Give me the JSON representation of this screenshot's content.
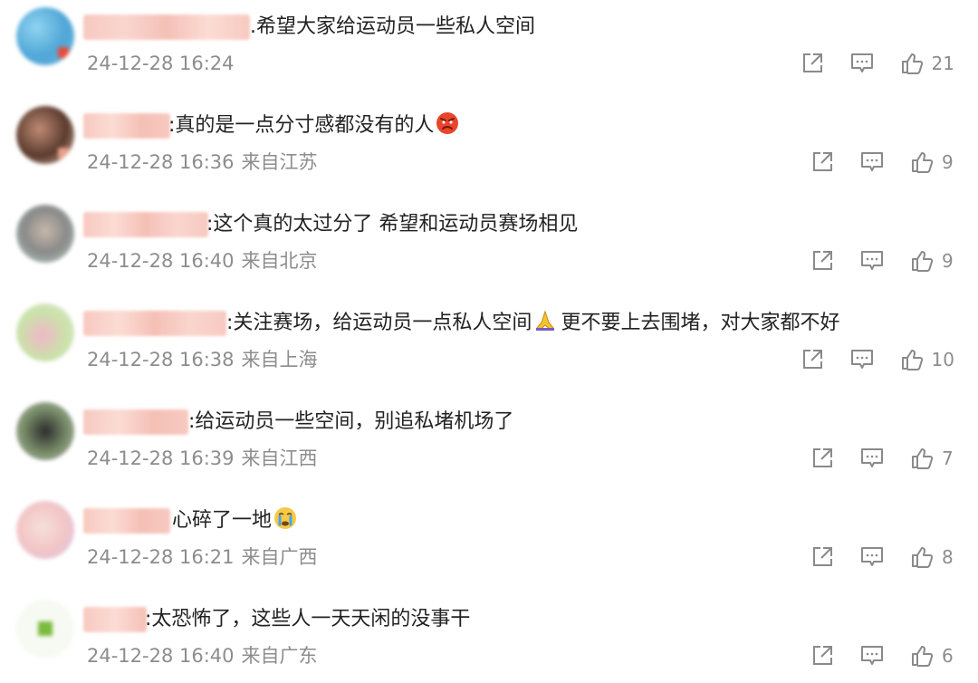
{
  "comments": [
    {
      "text": "希望大家给运动员一些私人空间",
      "prefix": ".",
      "time": "24-12-28 16:24",
      "location": "",
      "likes": "21",
      "avatar_colors": [
        "#4fa6d6",
        "#8fd3f0",
        "#e74c3c"
      ],
      "name_width": 184,
      "text_left": 276
    },
    {
      "text": "真的是一点分寸感都没有的人",
      "prefix": ":",
      "emoji": "angry-face-emoji",
      "time": "24-12-28 16:36",
      "location": "来自江苏",
      "likes": "9",
      "avatar_colors": [
        "#5a3b2e",
        "#c08a75",
        "#e8c4b0"
      ],
      "name_width": 96,
      "text_left": 186
    },
    {
      "text": "这个真的太过分了 希望和运动员赛场相见",
      "prefix": ":",
      "time": "24-12-28 16:40",
      "location": "来自北京",
      "likes": "9",
      "avatar_colors": [
        "#8a8a8a",
        "#c7b8a8",
        "#b9d6c9"
      ],
      "name_width": 138,
      "text_left": 228
    },
    {
      "text": "关注赛场，给运动员一点私人空间",
      "prefix": ":",
      "emoji2": "pray-hands-emoji",
      "text_after": "更不要上去围堵，对大家都不好",
      "time": "24-12-28 16:38",
      "location": "来自上海",
      "likes": "10",
      "avatar_colors": [
        "#c9e3a8",
        "#f0b8c8",
        "#e6e6e6"
      ],
      "name_width": 158,
      "text_left": 250
    },
    {
      "text": "给运动员一些空间，别追私堵机场了",
      "prefix": ":",
      "time": "24-12-28 16:39",
      "location": "来自江西",
      "likes": "7",
      "avatar_colors": [
        "#2d2d2d",
        "#7a8f6a",
        "#bfbfbf"
      ],
      "name_width": 116,
      "text_left": 208
    },
    {
      "text": "心碎了一地",
      "prefix": "",
      "emoji": "crying-face-emoji",
      "time": "24-12-28 16:21",
      "location": "来自广西",
      "likes": "8",
      "avatar_colors": [
        "#f3c6c6",
        "#d7c0e6",
        "#f5e0d8"
      ],
      "name_width": 96,
      "text_left": 190
    },
    {
      "text": "太恐怖了，这些人一天天闲的没事干",
      "prefix": ":",
      "time": "24-12-28 16:40",
      "location": "来自广东",
      "likes": "6",
      "avatar_colors": [
        "#ffffff",
        "#7dbb3f",
        "#e8f3dc"
      ],
      "name_width": 70,
      "text_left": 160
    }
  ],
  "colors": {
    "meta_gray": "#8d8d8d",
    "icon_gray": "#8a8a8a",
    "name_blur": "#f7c9c0"
  }
}
